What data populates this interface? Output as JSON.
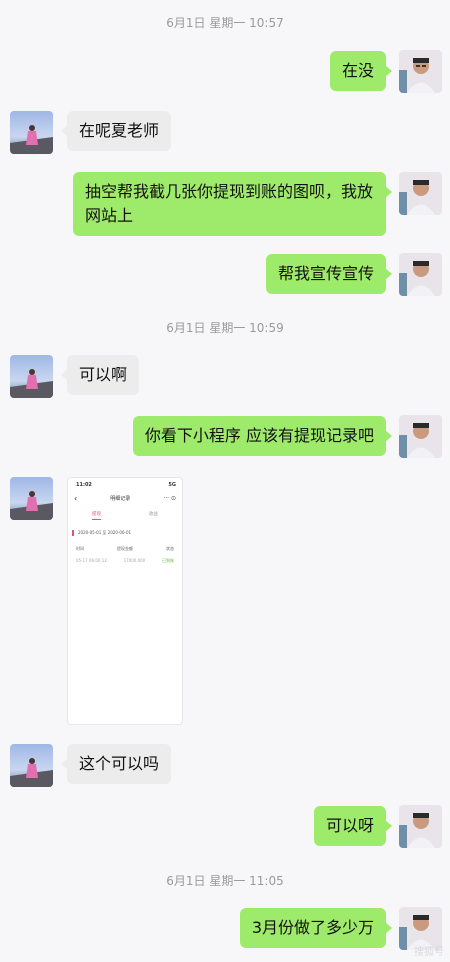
{
  "timestamps": [
    "6月1日 星期一 10:57",
    "6月1日 星期一 10:59",
    "6月1日 星期一 11:05"
  ],
  "messages": {
    "m1": "在没",
    "m2": "在呢夏老师",
    "m3": "抽空帮我截几张你提现到账的图呗，我放网站上",
    "m4": "帮我宣传宣传",
    "m5": "可以啊",
    "m6": "你看下小程序 应该有提现记录吧",
    "m8": "这个可以吗",
    "m9": "可以呀",
    "m10": "3月份做了多少万"
  },
  "screenshot": {
    "time": "11:02",
    "signal": "5G",
    "title": "明细记录",
    "tab_active": "提现",
    "tab_other": "收益",
    "date_range": "2020-05-01 至 2020-06-01",
    "col1": "时间",
    "col2": "提现金额",
    "col3": "状态",
    "row_time": "05-17 06:00:12",
    "row_amount": "17000.000",
    "row_status": "已到账"
  },
  "watermark": "搜狐号"
}
